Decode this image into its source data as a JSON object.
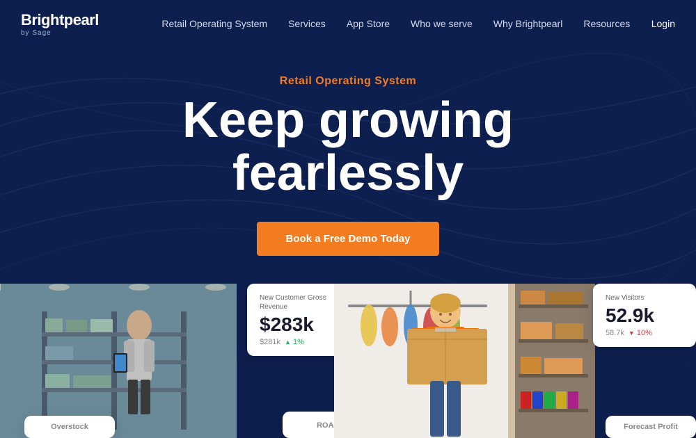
{
  "nav": {
    "logo": "Brightpearl",
    "logo_sub": "by Sage",
    "links": [
      {
        "label": "Retail Operating System",
        "id": "nav-retail"
      },
      {
        "label": "Services",
        "id": "nav-services"
      },
      {
        "label": "App Store",
        "id": "nav-appstore"
      },
      {
        "label": "Who we serve",
        "id": "nav-who"
      },
      {
        "label": "Why Brightpearl",
        "id": "nav-why"
      },
      {
        "label": "Resources",
        "id": "nav-resources"
      }
    ],
    "login_label": "Login"
  },
  "hero": {
    "tagline": "Retail Operating System",
    "title_line1": "Keep growing",
    "title_line2": "fearlessly",
    "cta_label": "Book a Free Demo Today"
  },
  "cards": {
    "revenue": {
      "label": "New Customer Gross Revenue",
      "value": "$283k",
      "sub_value": "$281k",
      "change": "▲ 1%",
      "change_type": "up"
    },
    "visitors": {
      "label": "New Visitors",
      "value": "52.9k",
      "sub_value": "58.7k",
      "change": "▼ 10%",
      "change_type": "down"
    },
    "overstock": {
      "label": "Overstock"
    },
    "roas": {
      "label": "ROAS"
    },
    "forecast": {
      "label": "Forecast Profit"
    }
  }
}
